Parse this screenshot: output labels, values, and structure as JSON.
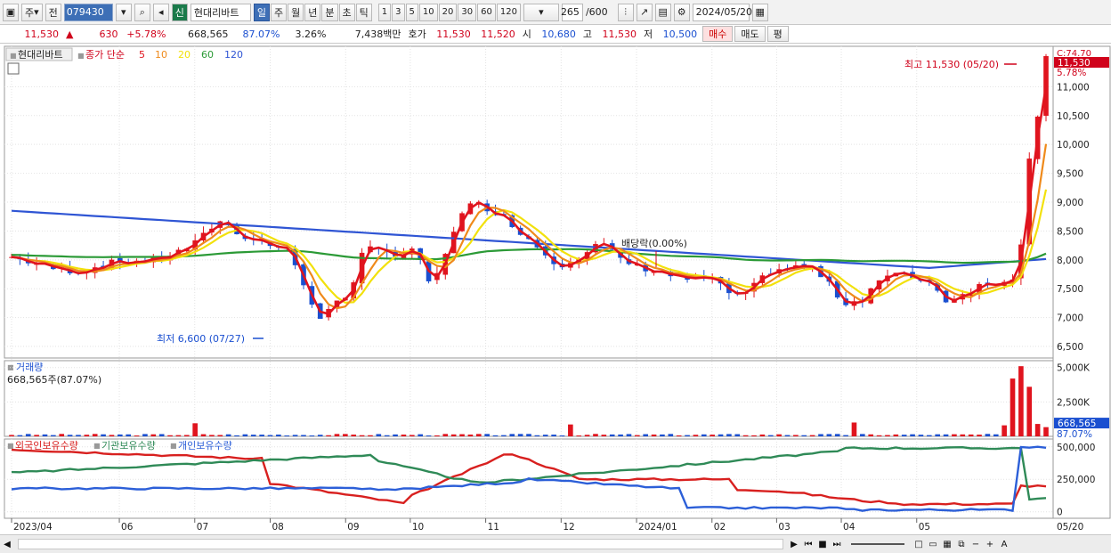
{
  "toolbar": {
    "type_label": "주",
    "prev_label": "전",
    "code": "079430",
    "credit_badge": "신",
    "stock_name": "현대리바트",
    "periods": [
      "일",
      "주",
      "월",
      "년",
      "분",
      "초",
      "틱"
    ],
    "active_period": "일",
    "intervals": [
      "1",
      "3",
      "5",
      "10",
      "20",
      "30",
      "60",
      "120"
    ],
    "count": "265",
    "count_total": "/600",
    "date": "2024/05/20"
  },
  "quote": {
    "price": "11,530",
    "change": "630",
    "change_pct": "+5.78%",
    "volume": "668,565",
    "vol_ratio": "87.07%",
    "turnover": "3.26%",
    "amount": "7,438백만",
    "bid_ask_label": "호가",
    "ask": "11,530",
    "bid": "11,520",
    "open_label": "시",
    "open": "10,680",
    "high_label": "고",
    "high": "11,530",
    "low_label": "저",
    "low": "10,500",
    "buy_label": "매수",
    "sell_label": "매도",
    "avg_label": "평"
  },
  "legend": {
    "stock": "현대리바트",
    "ma_prefix": "종가 단순",
    "ma_periods": [
      "5",
      "10",
      "20",
      "60",
      "120"
    ]
  },
  "volume_panel": {
    "title": "거래량",
    "current": "668,565주(87.07%)"
  },
  "holdings_panel": {
    "series": [
      "외국인보유수량",
      "기관보유수량",
      "개인보유수량"
    ]
  },
  "annotations": {
    "high": "최고 11,530 (05/20)",
    "low": "최저 6,600 (07/27)",
    "dividend": "배당락(0.00%)",
    "c_label": "C:74.70",
    "tag_price": "11,530",
    "tag_pct": "5.78%",
    "vol_tag": "668,565",
    "vol_pct": "87.07%"
  },
  "chart_data": [
    {
      "type": "candlestick",
      "title": "현대리바트 종가 단순 5 10 20 60 120",
      "x_labels": [
        "2023/04",
        "06",
        "07",
        "08",
        "09",
        "10",
        "11",
        "12",
        "2024/01",
        "02",
        "03",
        "04",
        "05",
        "05/20"
      ],
      "y_ticks": [
        6500,
        7000,
        7500,
        8000,
        8500,
        9000,
        9500,
        10000,
        10500,
        11000
      ],
      "ylim": [
        6300,
        11700
      ],
      "series": [
        {
          "name": "5",
          "color": "#e0141e"
        },
        {
          "name": "10",
          "color": "#ef8a1b"
        },
        {
          "name": "20",
          "color": "#f2e10c"
        },
        {
          "name": "60",
          "color": "#2b9a36"
        },
        {
          "name": "120",
          "color": "#2f55d4"
        }
      ],
      "close_path": [
        [
          0,
          8050
        ],
        [
          5,
          7850
        ],
        [
          8,
          7800
        ],
        [
          12,
          7950
        ],
        [
          17,
          8000
        ],
        [
          20,
          8150
        ],
        [
          22,
          8300
        ],
        [
          24,
          8600
        ],
        [
          25,
          8700
        ],
        [
          27,
          8450
        ],
        [
          30,
          8300
        ],
        [
          33,
          8150
        ],
        [
          35,
          7500
        ],
        [
          37,
          6850
        ],
        [
          38,
          7200
        ],
        [
          40,
          7350
        ],
        [
          42,
          8300
        ],
        [
          45,
          8050
        ],
        [
          48,
          8150
        ],
        [
          50,
          7500
        ],
        [
          53,
          8700
        ],
        [
          55,
          9000
        ],
        [
          58,
          8800
        ],
        [
          62,
          8300
        ],
        [
          65,
          7900
        ],
        [
          68,
          8100
        ],
        [
          70,
          8300
        ],
        [
          72,
          8050
        ],
        [
          74,
          7900
        ],
        [
          77,
          7800
        ],
        [
          79,
          7700
        ],
        [
          81,
          7650
        ],
        [
          83,
          7700
        ],
        [
          85,
          7450
        ],
        [
          87,
          7350
        ],
        [
          88,
          7500
        ],
        [
          90,
          7800
        ],
        [
          92,
          7850
        ],
        [
          95,
          7900
        ],
        [
          97,
          7600
        ],
        [
          99,
          7250
        ],
        [
          101,
          7300
        ],
        [
          103,
          7650
        ],
        [
          105,
          7750
        ],
        [
          107,
          7700
        ],
        [
          109,
          7650
        ],
        [
          111,
          7300
        ],
        [
          113,
          7400
        ],
        [
          115,
          7550
        ],
        [
          117,
          7600
        ],
        [
          119,
          7700
        ],
        [
          120,
          8200
        ],
        [
          121,
          9800
        ],
        [
          122,
          10500
        ],
        [
          123,
          11530
        ]
      ],
      "high": {
        "value": 11530,
        "date": "05/20"
      },
      "low": {
        "value": 6600,
        "date": "07/27"
      }
    },
    {
      "type": "bar",
      "title": "거래량",
      "y_ticks": [
        "5,000K",
        "2,500K"
      ],
      "ylim": [
        0,
        5500000
      ],
      "current": 668565
    },
    {
      "type": "line",
      "series": [
        {
          "name": "외국인보유수량",
          "color": "#d8201f"
        },
        {
          "name": "기관보유수량",
          "color": "#2f8a57"
        },
        {
          "name": "개인보유수량",
          "color": "#2c5fd8"
        }
      ],
      "y_ticks": [
        "500,000",
        "250,000",
        "0"
      ],
      "ylim": [
        -50000,
        560000
      ]
    }
  ]
}
